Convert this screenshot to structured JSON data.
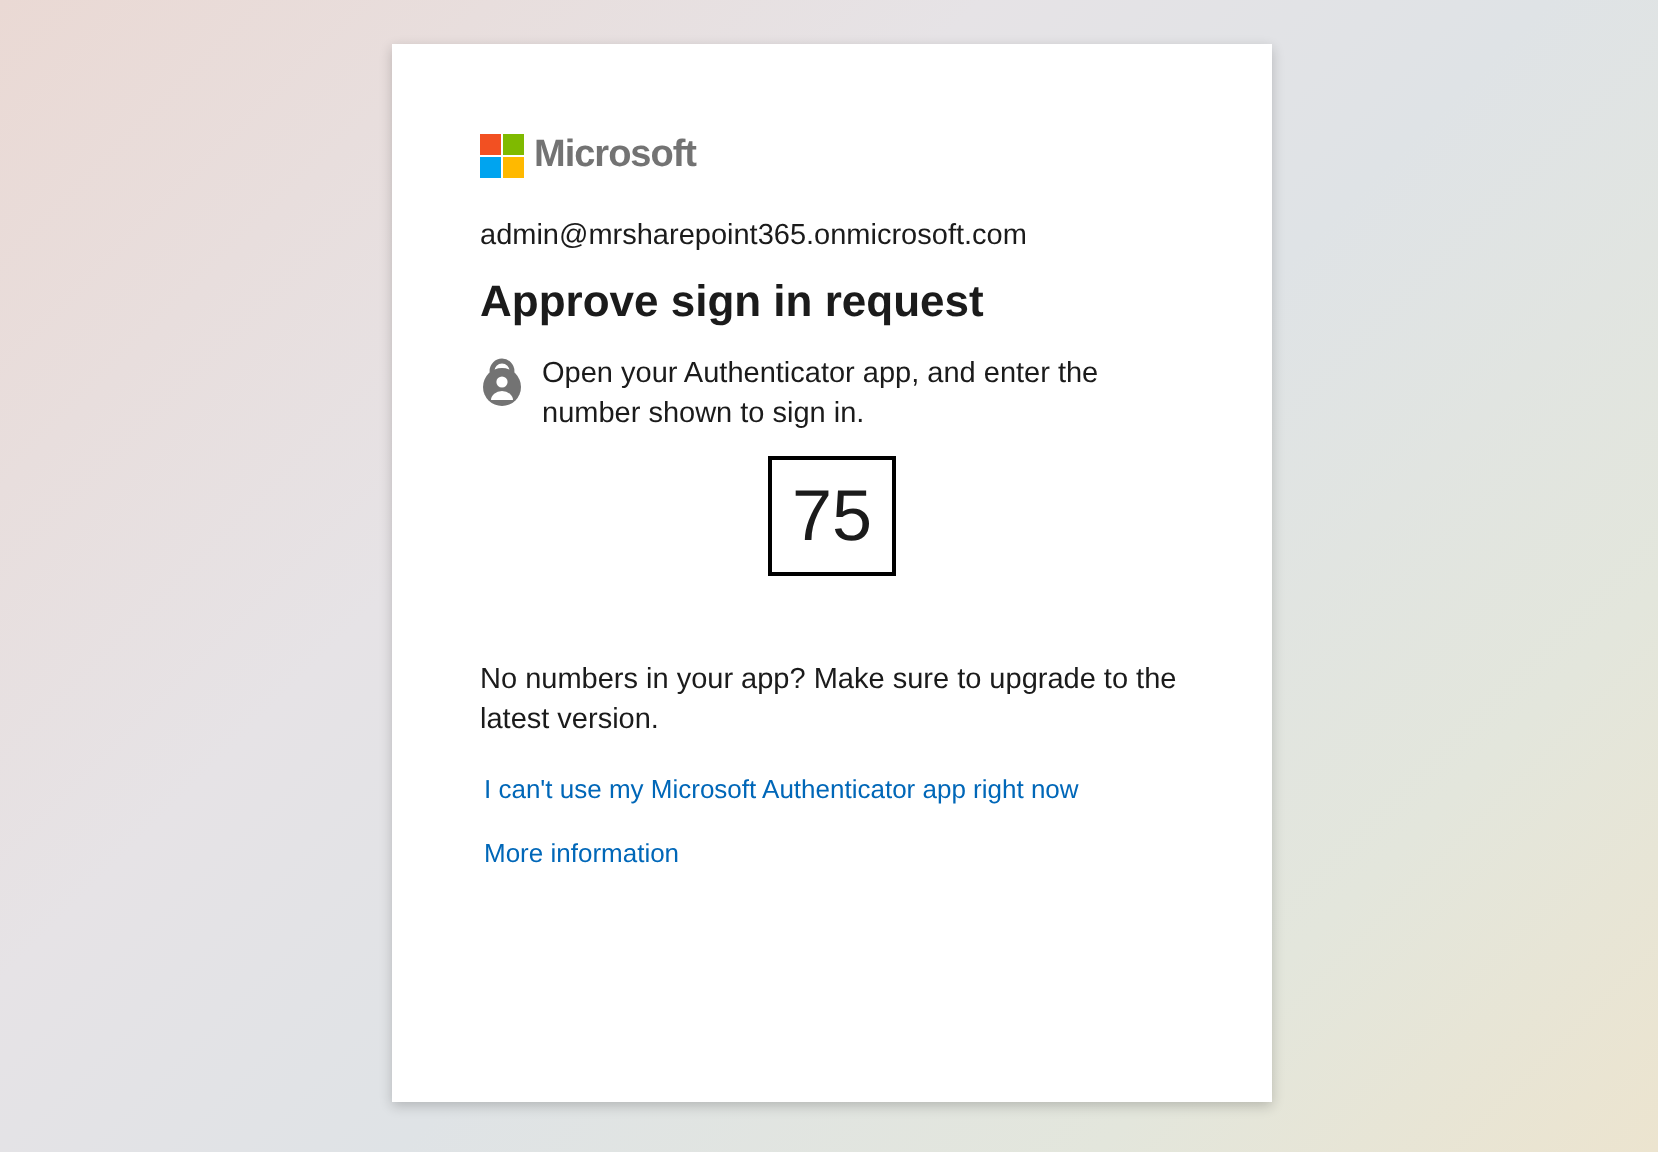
{
  "brand": {
    "name": "Microsoft"
  },
  "account": "admin@mrsharepoint365.onmicrosoft.com",
  "title": "Approve sign in request",
  "instruction": "Open your Authenticator app, and enter the number shown to sign in.",
  "number": "75",
  "note": "No numbers in your app? Make sure to upgrade to the latest version.",
  "links": [
    "I can't use my Microsoft Authenticator app right now",
    "More information"
  ]
}
